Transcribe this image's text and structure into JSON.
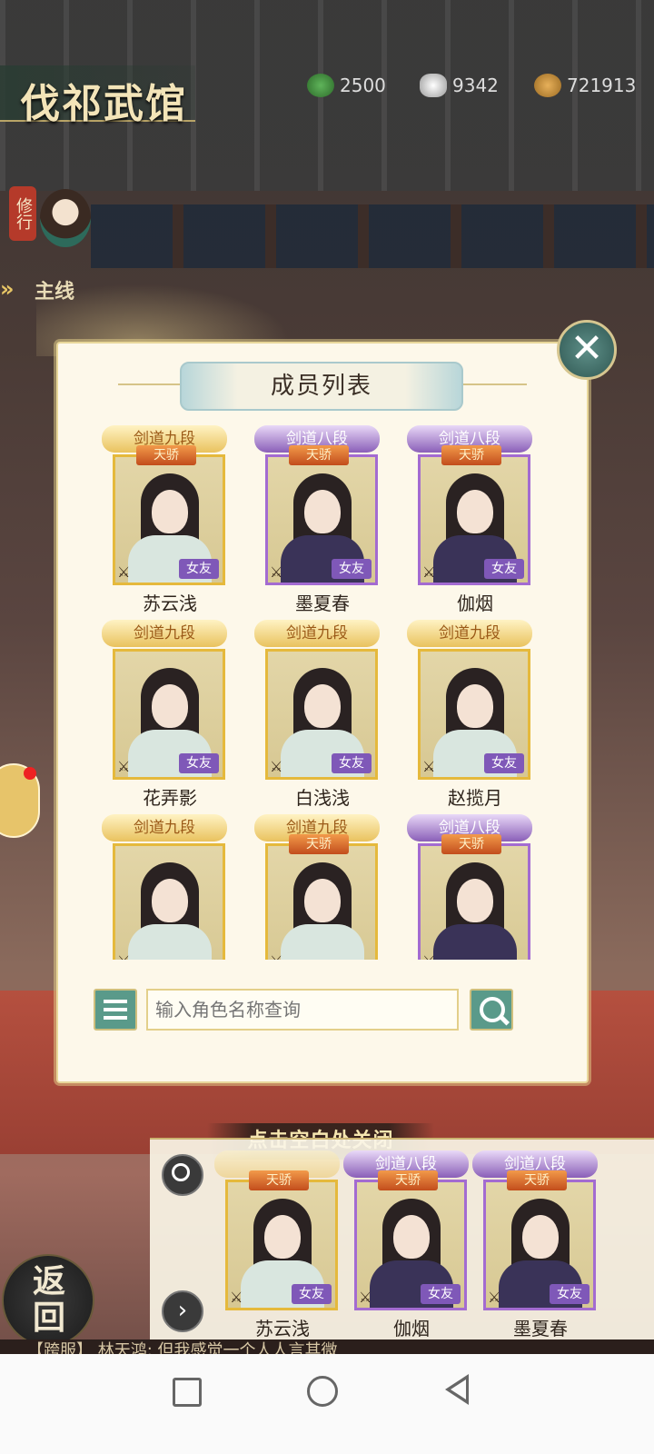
{
  "header": {
    "title": "伐祁武馆",
    "resources": [
      {
        "icon": "jade-coin-icon",
        "value": "2500"
      },
      {
        "icon": "silver-ingot-icon",
        "value": "9342"
      },
      {
        "icon": "copper-coin-icon",
        "value": "721913"
      }
    ]
  },
  "side": {
    "xiuxing": "修行",
    "zhuxian": "主线"
  },
  "modal": {
    "title": "成员列表",
    "search_placeholder": "输入角色名称查询",
    "members": [
      {
        "name": "苏云浅",
        "rank": "剑道九段",
        "rank_color": "gold",
        "tianjiao": "天骄",
        "role": "女友"
      },
      {
        "name": "墨夏春",
        "rank": "剑道八段",
        "rank_color": "purple",
        "tianjiao": "天骄",
        "role": "女友"
      },
      {
        "name": "伽烟",
        "rank": "剑道八段",
        "rank_color": "purple",
        "tianjiao": "天骄",
        "role": "女友"
      },
      {
        "name": "花弄影",
        "rank": "剑道九段",
        "rank_color": "gold",
        "tianjiao": "",
        "role": "女友"
      },
      {
        "name": "白浅浅",
        "rank": "剑道九段",
        "rank_color": "gold",
        "tianjiao": "",
        "role": "女友"
      },
      {
        "name": "赵揽月",
        "rank": "剑道九段",
        "rank_color": "gold",
        "tianjiao": "",
        "role": "女友"
      },
      {
        "name": "",
        "rank": "剑道九段",
        "rank_color": "gold",
        "tianjiao": "",
        "role": ""
      },
      {
        "name": "",
        "rank": "剑道九段",
        "rank_color": "gold",
        "tianjiao": "天骄",
        "role": ""
      },
      {
        "name": "",
        "rank": "剑道八段",
        "rank_color": "purple",
        "tianjiao": "天骄",
        "role": ""
      }
    ]
  },
  "hint": "点击空白处关闭",
  "strip": {
    "cards": [
      {
        "name": "苏云浅",
        "rank": "",
        "tianjiao": "天骄",
        "role": "女友",
        "rank_color": "gold"
      },
      {
        "name": "伽烟",
        "rank": "剑道八段",
        "tianjiao": "天骄",
        "role": "女友",
        "rank_color": "purple"
      },
      {
        "name": "墨夏春",
        "rank": "剑道八段",
        "tianjiao": "天骄",
        "role": "女友",
        "rank_color": "purple"
      }
    ]
  },
  "back_label": "返回",
  "chat_text": "【跨服】 林天鸿: 但我感觉一个人人言其微",
  "colors": {
    "accent_teal": "#5a9a8a",
    "gold": "#e5b93c",
    "purple": "#a36bd1"
  }
}
